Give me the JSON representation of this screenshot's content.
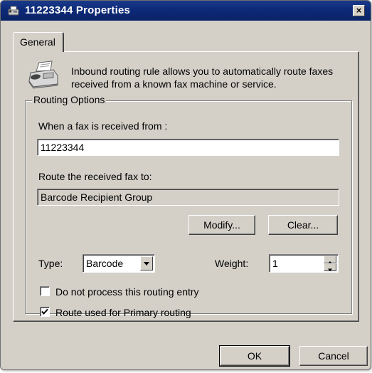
{
  "window": {
    "title": "11223344 Properties",
    "title_icon": "fax-routing-icon",
    "close_label": "×"
  },
  "tabs": [
    {
      "label": "General",
      "selected": true
    }
  ],
  "description": {
    "icon": "fax-machine-icon",
    "text": "Inbound routing rule allows you to automatically route faxes received from a known fax machine or service."
  },
  "routing_options": {
    "legend": "Routing Options",
    "received_from_label": "When a fax is received from :",
    "received_from_value": "11223344",
    "route_to_label": "Route the received fax to:",
    "route_to_value": "Barcode Recipient Group",
    "modify_label": "Modify...",
    "clear_label": "Clear...",
    "type_label": "Type:",
    "type_value": "Barcode",
    "weight_label": "Weight:",
    "weight_value": "1",
    "do_not_process_label": "Do not process this routing entry",
    "do_not_process_checked": false,
    "primary_route_label": "Route used for Primary routing",
    "primary_route_checked": true
  },
  "footer": {
    "ok_label": "OK",
    "cancel_label": "Cancel"
  },
  "colors": {
    "titlebar": "#0d2a78",
    "dialog_face": "#d4d0c8",
    "disabled_field": "#d4d0c8"
  }
}
